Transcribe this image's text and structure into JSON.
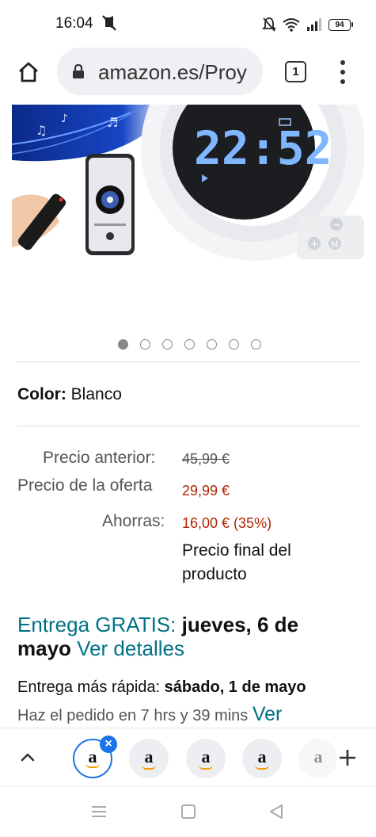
{
  "status_bar": {
    "time": "16:04",
    "battery": "94",
    "icons": [
      "mute-icon",
      "alarm-off-icon",
      "wifi-icon",
      "signal-icon",
      "battery-icon"
    ]
  },
  "browser": {
    "url": "amazon.es/Proy",
    "tab_count": "1",
    "icons": [
      "home-icon",
      "lock-icon",
      "tabs-icon",
      "more-vert-icon"
    ]
  },
  "product": {
    "clock_display": "22:52",
    "carousel": {
      "count": 7,
      "active": 0
    },
    "color_label": "Color:",
    "color_value": "Blanco"
  },
  "pricing": {
    "previous_label": "Precio anterior:",
    "previous_value": "45,99 €",
    "offer_label": "Precio de la oferta",
    "offer_value": "29,99 €",
    "savings_label": "Ahorras:",
    "savings_value": "16,00 € (35%)",
    "final_note": "Precio final del producto",
    "price_color": "#b12704"
  },
  "delivery": {
    "free_label": "Entrega GRATIS:",
    "date": "jueves, 6 de mayo",
    "details_link": "Ver detalles",
    "fast_label": "Entrega más rápida:",
    "fast_date": "sábado, 1 de mayo",
    "order_text": "Haz el pedido en 7 hrs y 39 mins",
    "order_link": "Ver",
    "link_color": "#007185"
  },
  "tab_bar": {
    "tab_letter": "a",
    "close_symbol": "×",
    "accent_color": "#1a73e8"
  }
}
